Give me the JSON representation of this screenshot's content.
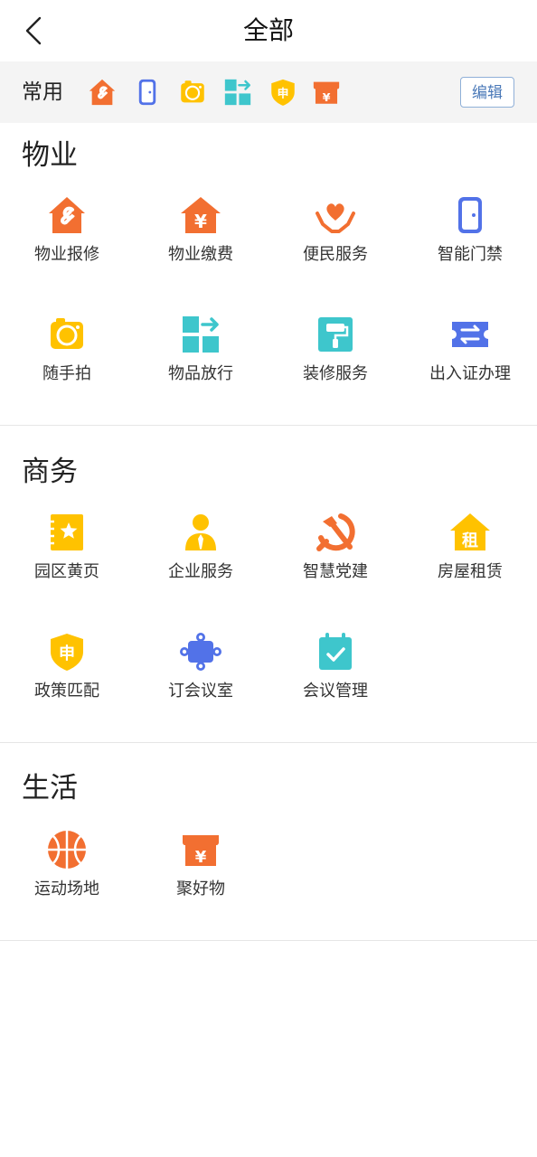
{
  "header": {
    "title": "全部"
  },
  "favorites": {
    "label": "常用",
    "edit_label": "编辑",
    "icons": [
      "house-wrench-icon",
      "door-icon",
      "camera-icon",
      "goods-release-icon",
      "shield-apply-icon",
      "shop-yen-icon"
    ]
  },
  "sections": [
    {
      "title": "物业",
      "items": [
        {
          "label": "物业报修",
          "icon": "house-wrench-icon"
        },
        {
          "label": "物业缴费",
          "icon": "house-yen-icon"
        },
        {
          "label": "便民服务",
          "icon": "heart-hands-icon"
        },
        {
          "label": "智能门禁",
          "icon": "door-icon"
        },
        {
          "label": "随手拍",
          "icon": "camera-icon"
        },
        {
          "label": "物品放行",
          "icon": "goods-release-icon"
        },
        {
          "label": "装修服务",
          "icon": "paint-roller-icon"
        },
        {
          "label": "出入证办理",
          "icon": "pass-ticket-icon"
        }
      ]
    },
    {
      "title": "商务",
      "items": [
        {
          "label": "园区黄页",
          "icon": "yellow-pages-icon"
        },
        {
          "label": "企业服务",
          "icon": "person-tie-icon"
        },
        {
          "label": "智慧党建",
          "icon": "hammer-sickle-icon"
        },
        {
          "label": "房屋租赁",
          "icon": "house-rent-icon"
        },
        {
          "label": "政策匹配",
          "icon": "shield-apply-icon"
        },
        {
          "label": "订会议室",
          "icon": "meeting-puzzle-icon"
        },
        {
          "label": "会议管理",
          "icon": "calendar-check-icon"
        }
      ]
    },
    {
      "title": "生活",
      "items": [
        {
          "label": "运动场地",
          "icon": "basketball-icon"
        },
        {
          "label": "聚好物",
          "icon": "shop-yen-icon"
        }
      ]
    }
  ],
  "colors": {
    "orange": "#f26f31",
    "blue": "#5272e8",
    "yellow": "#ffc200",
    "teal": "#3ec6cc",
    "fav_bg": "#f4f4f4"
  }
}
